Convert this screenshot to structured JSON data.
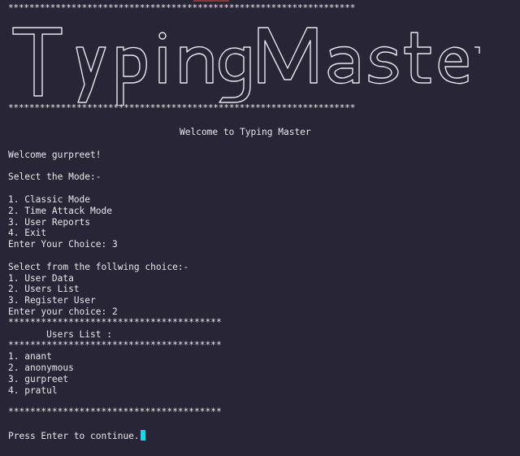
{
  "banner": {
    "border": "******************************************************************",
    "title_art": "Typing Master"
  },
  "welcome_heading": "Welcome to Typing Master",
  "greeting": "Welcome gurpreet!",
  "mode_prompt": "Select the Mode:-",
  "modes": [
    "1. Classic Mode",
    "2. Time Attack Mode",
    "3. User Reports",
    "4. Exit"
  ],
  "mode_choice_prompt": "Enter Your Choice: 3",
  "report_prompt": "Select from the follwing choice:-",
  "report_options": [
    "1. User Data",
    "2. Users List",
    "3. Register User"
  ],
  "report_choice_prompt": "Enter your choice: 2",
  "divider": "***************************************",
  "users_list_heading": "       Users List :",
  "users": [
    "1. anant",
    "2. anonymous",
    "3. gurpreet",
    "4. pratul"
  ],
  "continue_prompt": "Press Enter to continue.",
  "colors": {
    "background": "#272536",
    "text": "#e8e8ea",
    "cursor": "#22d3ee"
  }
}
